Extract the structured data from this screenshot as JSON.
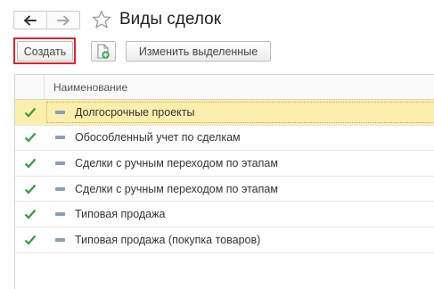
{
  "header": {
    "title": "Виды сделок",
    "back_icon": "arrow-left-icon",
    "forward_icon": "arrow-right-icon",
    "favorite_icon": "star-icon"
  },
  "toolbar": {
    "create_label": "Создать",
    "copy_icon": "copy-document-icon",
    "edit_label": "Изменить выделенные"
  },
  "table": {
    "column_header": "Наименование",
    "rows": [
      {
        "name": "Долгосрочные проекты",
        "checked": true,
        "selected": true
      },
      {
        "name": "Обособленный учет по сделкам",
        "checked": true,
        "selected": false
      },
      {
        "name": "Сделки с ручным переходом по этапам",
        "checked": true,
        "selected": false
      },
      {
        "name": "Сделки с ручным переходом по этапам",
        "checked": true,
        "selected": false
      },
      {
        "name": "Типовая продажа",
        "checked": true,
        "selected": false
      },
      {
        "name": "Типовая продажа (покупка товаров)",
        "checked": true,
        "selected": false
      }
    ]
  },
  "colors": {
    "highlight": "#e1222b",
    "selected_row": "#fcefad",
    "checkmark": "#2f9e3f"
  }
}
